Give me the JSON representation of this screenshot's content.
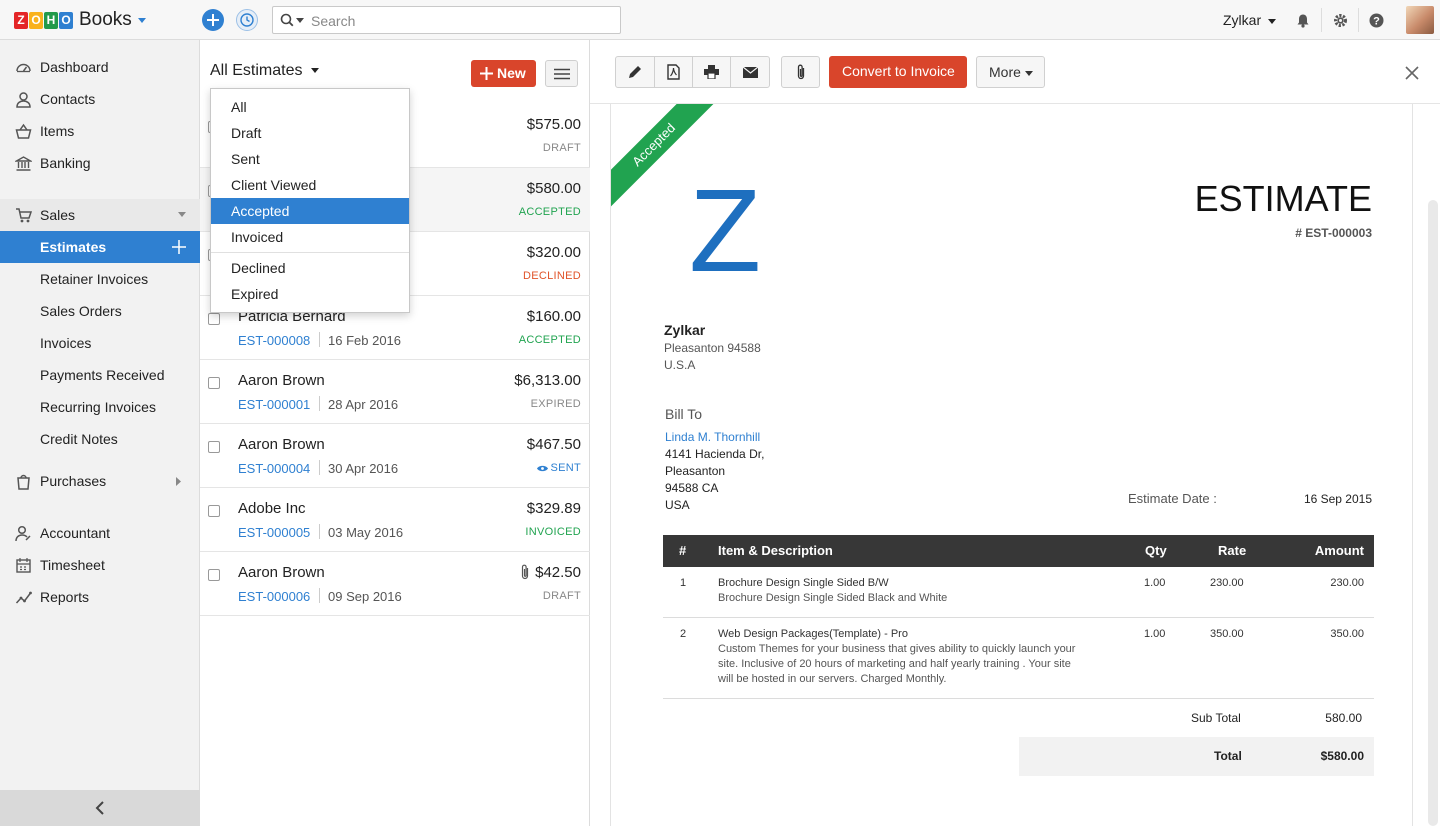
{
  "app": {
    "logo_letters": [
      "Z",
      "O",
      "H",
      "O"
    ],
    "logo_colors": [
      "#e42527",
      "#f9b21d",
      "#229a4b",
      "#2f80d1"
    ],
    "name": "Books"
  },
  "topbar": {
    "search_placeholder": "Search",
    "org_name": "Zylkar"
  },
  "sidebar": {
    "items": [
      {
        "label": "Dashboard",
        "icon": "dashboard-icon"
      },
      {
        "label": "Contacts",
        "icon": "user-icon"
      },
      {
        "label": "Items",
        "icon": "basket-icon"
      },
      {
        "label": "Banking",
        "icon": "bank-icon"
      },
      {
        "label": "Sales",
        "icon": "cart-icon"
      },
      {
        "label": "Estimates"
      },
      {
        "label": "Retainer Invoices"
      },
      {
        "label": "Sales Orders"
      },
      {
        "label": "Invoices"
      },
      {
        "label": "Payments Received"
      },
      {
        "label": "Recurring Invoices"
      },
      {
        "label": "Credit Notes"
      },
      {
        "label": "Purchases",
        "icon": "bag-icon"
      },
      {
        "label": "Accountant",
        "icon": "accountant-icon"
      },
      {
        "label": "Timesheet",
        "icon": "calendar-icon"
      },
      {
        "label": "Reports",
        "icon": "reports-icon"
      }
    ]
  },
  "list": {
    "view_title": "All Estimates",
    "new_label": "New",
    "filter_options": [
      "All",
      "Draft",
      "Sent",
      "Client Viewed",
      "Accepted",
      "Invoiced",
      "Declined",
      "Expired"
    ],
    "selected_filter": "Accepted",
    "rows": [
      {
        "name": "",
        "amount": "$575.00",
        "number": "",
        "date": "",
        "status": "DRAFT",
        "status_color": "#888888"
      },
      {
        "name": "",
        "amount": "$580.00",
        "number": "",
        "date": "",
        "status": "ACCEPTED",
        "status_color": "#21a350"
      },
      {
        "name": "",
        "amount": "$320.00",
        "number": "",
        "date": "",
        "status": "DECLINED",
        "status_color": "#e0542a"
      },
      {
        "name": "Patricia Bernard",
        "amount": "$160.00",
        "number": "EST-000008",
        "date": "16 Feb 2016",
        "status": "ACCEPTED",
        "status_color": "#21a350"
      },
      {
        "name": "Aaron Brown",
        "amount": "$6,313.00",
        "number": "EST-000001",
        "date": "28 Apr 2016",
        "status": "EXPIRED",
        "status_color": "#888888"
      },
      {
        "name": "Aaron Brown",
        "amount": "$467.50",
        "number": "EST-000004",
        "date": "30 Apr 2016",
        "status": "SENT",
        "status_color": "#2f80d1"
      },
      {
        "name": "Adobe Inc",
        "amount": "$329.89",
        "number": "EST-000005",
        "date": "03 May 2016",
        "status": "INVOICED",
        "status_color": "#21a350"
      },
      {
        "name": "Aaron Brown",
        "amount": "$42.50",
        "number": "EST-000006",
        "date": "09 Sep 2016",
        "status": "DRAFT",
        "status_color": "#888888"
      }
    ]
  },
  "detail": {
    "convert_label": "Convert to Invoice",
    "more_label": "More",
    "ribbon": "Accepted",
    "logo_letter": "Z",
    "title": "ESTIMATE",
    "number": "# EST-000003",
    "org": {
      "name": "Zylkar",
      "line1": "Pleasanton  94588",
      "line2": "U.S.A"
    },
    "bill_to_label": "Bill To",
    "customer": "Linda M. Thornhill",
    "address": [
      "4141 Hacienda Dr,",
      "Pleasanton",
      "94588 CA",
      "USA"
    ],
    "date_label": "Estimate Date :",
    "date_value": "16 Sep 2015",
    "table_headers": {
      "num": "#",
      "item": "Item & Description",
      "qty": "Qty",
      "rate": "Rate",
      "amount": "Amount"
    },
    "items": [
      {
        "n": "1",
        "name": "Brochure Design Single Sided B/W",
        "desc": [
          "Brochure Design Single Sided Black and White"
        ],
        "qty": "1.00",
        "rate": "230.00",
        "amount": "230.00"
      },
      {
        "n": "2",
        "name": "Web Design Packages(Template) - Pro",
        "desc": [
          "Custom Themes for your business that gives ability to quickly launch your",
          "site. Inclusive of 20 hours of marketing and half yearly training . Your site",
          "will be hosted in our servers.  Charged Monthly."
        ],
        "qty": "1.00",
        "rate": "350.00",
        "amount": "350.00"
      }
    ],
    "subtotal_label": "Sub Total",
    "subtotal": "580.00",
    "total_label": "Total",
    "total": "$580.00"
  }
}
